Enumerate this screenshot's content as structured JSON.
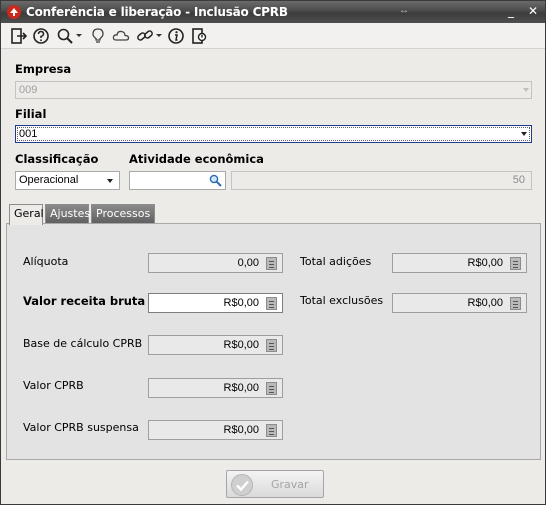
{
  "window": {
    "title": "Conferência e liberação - Inclusão CPRB",
    "resize_glyph": "↔",
    "minimize_glyph": "_",
    "close_glyph": "✕"
  },
  "toolbar": {
    "icons": [
      "exit-icon",
      "help-icon",
      "search-icon",
      "lightbulb-icon",
      "cloud-icon",
      "link-icon",
      "info-icon",
      "logout-icon"
    ]
  },
  "form": {
    "empresa": {
      "label": "Empresa",
      "value": "009"
    },
    "filial": {
      "label": "Filial",
      "value": "001"
    },
    "classificacao": {
      "label": "Classificação",
      "value": "Operacional"
    },
    "atividade": {
      "label": "Atividade econômica",
      "code": "",
      "description": "50"
    }
  },
  "tabs": [
    "Geral",
    "Ajustes",
    "Processos"
  ],
  "active_tab": "Geral",
  "geral": {
    "aliquota": {
      "label": "Alíquota",
      "value": "0,00"
    },
    "valor_receita_bruta": {
      "label": "Valor receita bruta",
      "value": "R$0,00"
    },
    "base_calculo": {
      "label": "Base de cálculo CPRB",
      "value": "R$0,00"
    },
    "valor_cprb": {
      "label": "Valor CPRB",
      "value": "R$0,00"
    },
    "valor_cprb_suspensa": {
      "label": "Valor CPRB suspensa",
      "value": "R$0,00"
    },
    "total_adicoes": {
      "label": "Total adições",
      "value": "R$0,00"
    },
    "total_exclusoes": {
      "label": "Total exclusões",
      "value": "R$0,00"
    }
  },
  "footer": {
    "gravar_label": "Gravar"
  },
  "colors": {
    "titlebar": "#4a4a4a",
    "window_bg": "#ecebe8",
    "panel_bg": "#e3e3e3",
    "focus_border": "#1f3c8a"
  }
}
